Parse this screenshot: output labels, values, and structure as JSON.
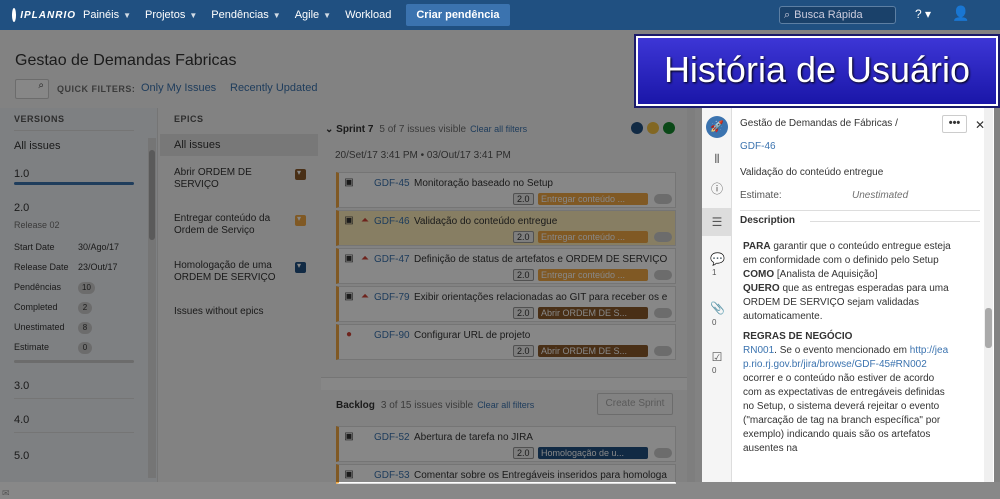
{
  "nav": {
    "logo": "IPLANRIO",
    "items": [
      "Painéis",
      "Projetos",
      "Pendências",
      "Agile"
    ],
    "workload": "Workload",
    "create": "Criar pendência",
    "search_placeholder": "Busca Rápida",
    "help": "?"
  },
  "page": {
    "title": "Gestao de Demandas Fabricas",
    "quick_filters_label": "QUICK FILTERS:",
    "filters": [
      "Only My Issues",
      "Recently Updated"
    ]
  },
  "versions": {
    "header": "VERSIONS",
    "all": "All issues",
    "v1": "1.0",
    "v2": "2.0",
    "v2_desc": "Release 02",
    "start_label": "Start Date",
    "start_value": "30/Ago/17",
    "release_label": "Release Date",
    "release_value": "23/Out/17",
    "pend_label": "Pendências",
    "pend_value": "10",
    "completed_label": "Completed",
    "completed_value": "2",
    "unest_label": "Unestimated",
    "unest_value": "8",
    "estimate_label": "Estimate",
    "estimate_value": "0",
    "v3": "3.0",
    "v4": "4.0",
    "v5": "5.0"
  },
  "epics": {
    "header": "EPICS",
    "all": "All issues",
    "items": [
      {
        "label": "Abrir ORDEM DE SERVIÇO",
        "color": "#8b5a2b"
      },
      {
        "label": "Entregar conteúdo da Ordem de Serviço",
        "color": "#f1a844"
      },
      {
        "label": "Homologação de uma ORDEM DE SERVIÇO",
        "color": "#205081"
      }
    ],
    "without": "Issues without epics"
  },
  "sprint": {
    "name": "Sprint 7",
    "visible": "5 of 7 issues visible",
    "clear": "Clear all filters",
    "dates": "20/Set/17 3:41 PM  •  03/Out/17 3:41 PM",
    "issues": [
      {
        "key": "GDF-45",
        "summary": "Monitoração baseado no Setup",
        "est": "2.0",
        "label": "Entregar conteúdo ...",
        "color": "#f1a844",
        "icon": "story",
        "selected": false
      },
      {
        "key": "GDF-46",
        "summary": "Validação do conteúdo entregue",
        "est": "2.0",
        "label": "Entregar conteúdo ...",
        "color": "#f1a844",
        "icon": "story",
        "selected": true
      },
      {
        "key": "GDF-47",
        "summary": "Definição de status de artefatos e ORDEM DE SERVIÇO",
        "est": "2.0",
        "label": "Entregar conteúdo ...",
        "color": "#f1a844",
        "icon": "story",
        "selected": false
      },
      {
        "key": "GDF-79",
        "summary": "Exibir orientações relacionadas ao GIT para receber os e",
        "est": "2.0",
        "label": "Abrir ORDEM DE S...",
        "color": "#8b5a2b",
        "icon": "story",
        "selected": false
      },
      {
        "key": "GDF-90",
        "summary": "Configurar URL de projeto",
        "est": "2.0",
        "label": "Abrir ORDEM DE S...",
        "color": "#8b5a2b",
        "icon": "bug",
        "selected": false
      }
    ]
  },
  "backlog": {
    "name": "Backlog",
    "visible": "3 of 15 issues visible",
    "clear": "Clear all filters",
    "create": "Create Sprint",
    "issues": [
      {
        "key": "GDF-52",
        "summary": "Abertura de tarefa no JIRA",
        "est": "2.0",
        "label": "Homologação de u...",
        "color": "#205081"
      },
      {
        "key": "GDF-53",
        "summary": "Comentar sobre os Entregáveis inseridos para homologa",
        "est": "",
        "label": "",
        "color": ""
      }
    ]
  },
  "detail": {
    "project": "Gestão de Demandas de Fábricas /",
    "key": "GDF-46",
    "summary": "Validação do conteúdo entregue",
    "estimate_label": "Estimate:",
    "estimate_value": "Unestimated",
    "section": "Description",
    "comments": "1",
    "attachments": "0",
    "subtasks": "0",
    "para_kw": "PARA",
    "para_txt": " garantir que o conteúdo entregue esteja em conformidade com o definido pelo Setup",
    "como_kw": "COMO",
    "como_txt": " [Analista de Aquisição]",
    "quero_kw": "QUERO",
    "quero_txt": " que as entregas esperadas para uma ORDEM DE SERVIÇO sejam validadas automaticamente.",
    "rules_title": "REGRAS DE NEGÓCIO",
    "rn_link": "RN001",
    "rn_txt1": ". Se o evento mencionado em ",
    "rn_url": "http://jeap.rio.rj.gov.br/jira/browse/GDF-45#RN002",
    "rn_txt2": " ocorrer e o conteúdo não estiver de acordo com as expectativas de entregáveis definidas no Setup, o sistema deverá rejeitar o evento (\"marcação de tag na branch específica\" por exemplo) indicando quais são os artefatos ausentes na"
  },
  "banner": "História de Usuário"
}
